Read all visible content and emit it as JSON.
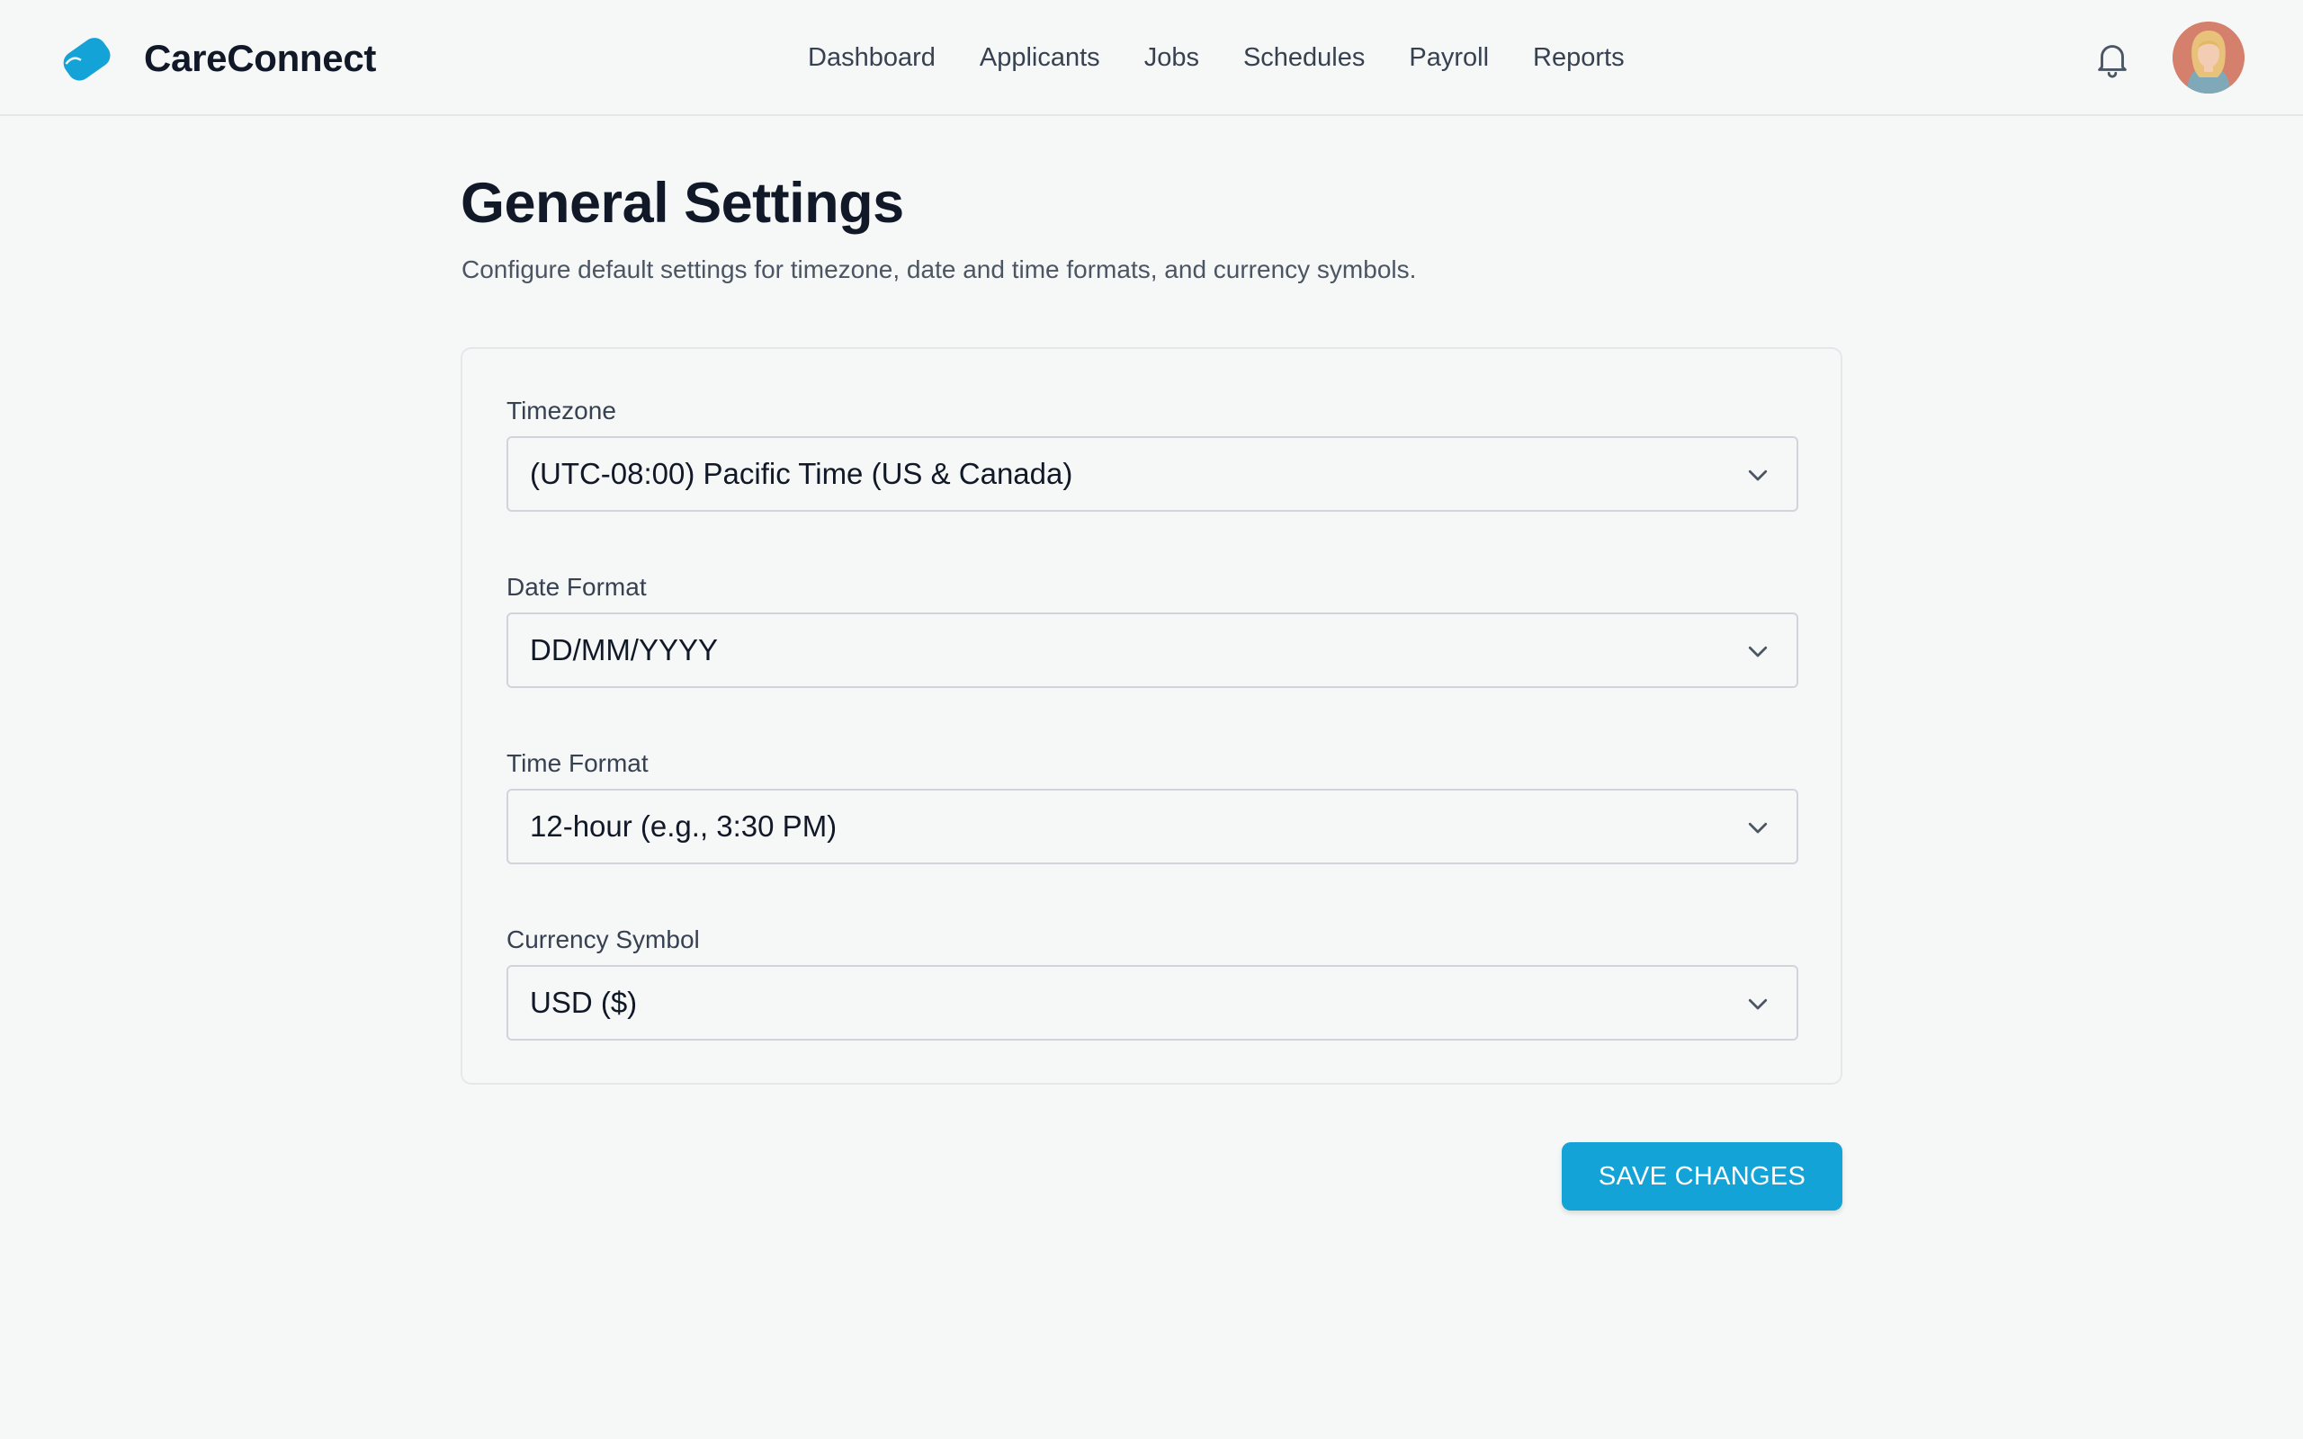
{
  "app": {
    "name": "CareConnect",
    "accent_color": "#14a3d6"
  },
  "nav": {
    "items": [
      {
        "label": "Dashboard"
      },
      {
        "label": "Applicants"
      },
      {
        "label": "Jobs"
      },
      {
        "label": "Schedules"
      },
      {
        "label": "Payroll"
      },
      {
        "label": "Reports"
      }
    ]
  },
  "header": {
    "bell_icon": "bell-icon",
    "avatar_icon": "user-avatar"
  },
  "page": {
    "title": "General Settings",
    "subtitle": "Configure default settings for timezone, date and time formats, and currency symbols."
  },
  "settings": {
    "fields": [
      {
        "label": "Timezone",
        "value": "(UTC-08:00) Pacific Time (US & Canada)"
      },
      {
        "label": "Date Format",
        "value": "DD/MM/YYYY"
      },
      {
        "label": "Time Format",
        "value": "12-hour (e.g., 3:30 PM)"
      },
      {
        "label": "Currency Symbol",
        "value": "USD ($)"
      }
    ]
  },
  "actions": {
    "save_label": "SAVE CHANGES"
  }
}
